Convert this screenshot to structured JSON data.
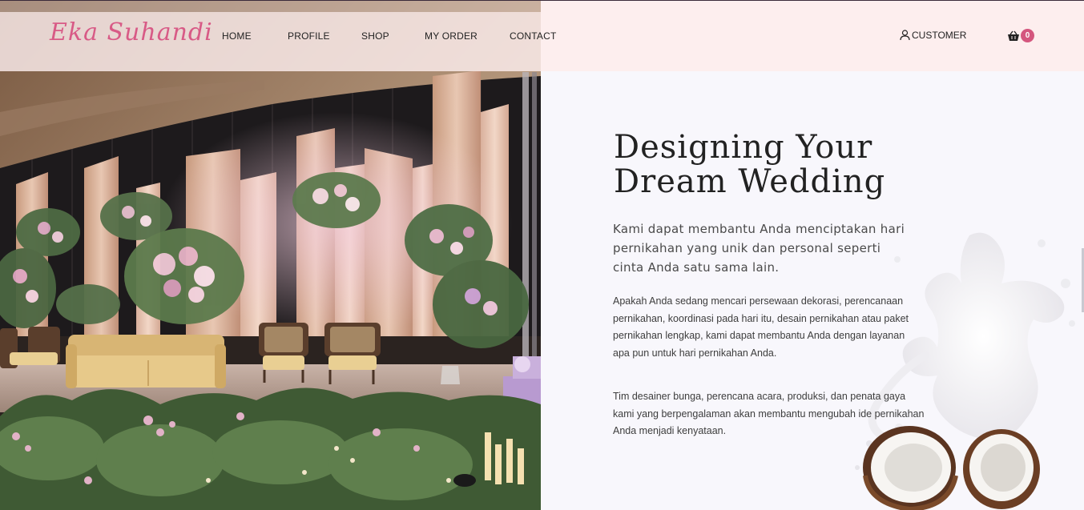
{
  "brand": {
    "logo_text": "Eka Suhandi",
    "accent": "#d85a86"
  },
  "nav": {
    "items": [
      {
        "label": "HOME"
      },
      {
        "label": "PROFILE"
      },
      {
        "label": "SHOP"
      },
      {
        "label": "MY ORDER"
      },
      {
        "label": "CONTACT"
      }
    ],
    "customer_label": "CUSTOMER",
    "customer_icon": "user-icon",
    "cart_icon": "basket-icon",
    "cart_count": "0"
  },
  "hero": {
    "image": "wedding-stage-decoration-photo",
    "headline_line1": "Designing Your",
    "headline_line2": "Dream Wedding",
    "lead": "Kami dapat membantu Anda menciptakan hari pernikahan yang unik dan personal seperti cinta Anda satu sama lain.",
    "paragraph1": "Apakah Anda sedang mencari persewaan dekorasi, perencanaan pernikahan, koordinasi pada hari itu, desain pernikahan atau paket pernikahan lengkap, kami dapat membantu Anda dengan layanan apa pun untuk hari pernikahan Anda.",
    "paragraph2": "Tim desainer bunga, perencana acara, produksi, dan penata gaya kami yang berpengalaman akan membantu mengubah ide pernikahan Anda menjadi kenyataan.",
    "decoration": "milk-splash-coconut-image"
  },
  "colors": {
    "header_bg": "#fdeeee",
    "content_bg": "#f8f7fc",
    "badge": "#d4567e"
  }
}
